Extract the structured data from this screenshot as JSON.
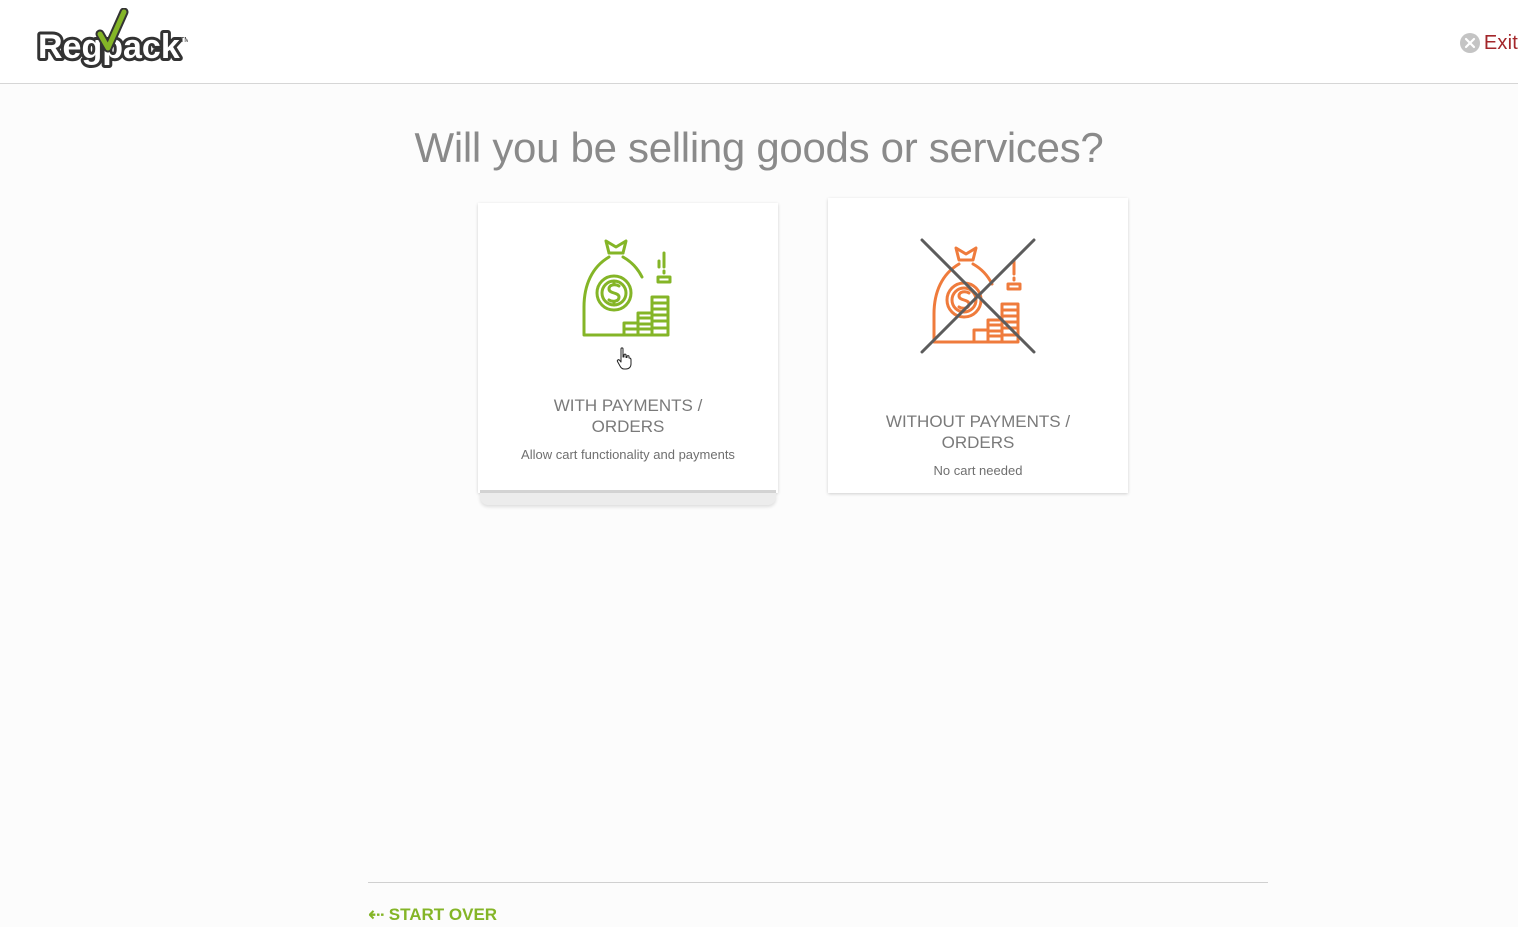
{
  "header": {
    "logo_text": "Regpack",
    "exit_label": "Exit"
  },
  "main": {
    "question": "Will you be selling goods or services?",
    "options": [
      {
        "title_line1": "WITH PAYMENTS /",
        "title_line2": "ORDERS",
        "subtitle": "Allow cart functionality and payments",
        "icon": "money-bag-coins-icon",
        "color": "#84b527"
      },
      {
        "title_line1": "WITHOUT PAYMENTS /",
        "title_line2": "ORDERS",
        "subtitle": "No cart needed",
        "icon": "money-bag-crossed-icon",
        "color": "#ef7b3c"
      }
    ]
  },
  "footer": {
    "start_over_label": "START OVER"
  },
  "colors": {
    "accent_green": "#84b527",
    "accent_orange": "#ef7b3c",
    "exit_red": "#a3262a"
  }
}
